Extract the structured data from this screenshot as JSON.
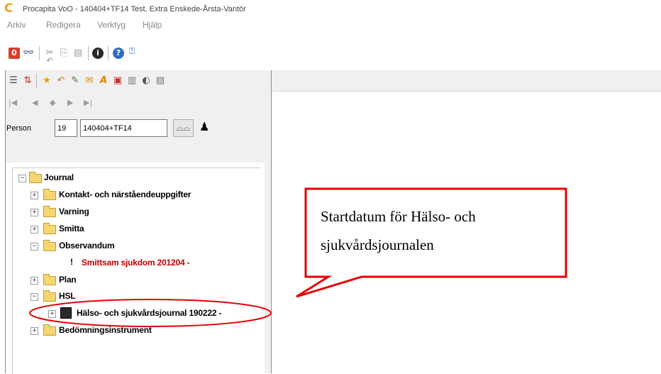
{
  "window": {
    "logo": "C",
    "title": "Procapita VoO - 140404+TF14 Test, Extra Enskede-Årsta-Vantör"
  },
  "menu": [
    "Arkiv",
    "Redigera",
    "Verktyg",
    "Hjälp"
  ],
  "toolbar1": [
    "stop-icon",
    "binoculars-icon",
    "cut-icon",
    "copy-icon",
    "paste-icon",
    "undo-icon",
    "info-icon",
    "help-icon",
    "context-help-icon"
  ],
  "toolbar2": [
    "indent-icon",
    "sort-icon",
    "star-icon",
    "undo-icon",
    "edit-icon",
    "mail-icon",
    "signature-icon",
    "form-icon",
    "book-icon",
    "circle-icon",
    "chart-icon"
  ],
  "nav": [
    "first-icon",
    "prev-icon",
    "current-icon",
    "next-icon",
    "last-icon"
  ],
  "person": {
    "label": "Person",
    "number": "19",
    "id": "140404+TF14"
  },
  "tree": {
    "root": "Journal",
    "items": [
      {
        "label": "Kontakt- och närståendeuppgifter",
        "expander": "+"
      },
      {
        "label": "Varning",
        "expander": "+"
      },
      {
        "label": "Smitta",
        "expander": "+"
      },
      {
        "label": "Observandum",
        "expander": "−"
      },
      {
        "label": "Smittsam sjukdom 201204 -",
        "expander": "",
        "warning": "!"
      },
      {
        "label": "Plan",
        "expander": "+"
      },
      {
        "label": "HSL",
        "expander": "−"
      },
      {
        "label": "Hälso- och sjukvårdsjournal 190222 -",
        "expander": "+"
      },
      {
        "label": "Bedömningsinstrument",
        "expander": "+"
      }
    ]
  },
  "callout": {
    "line1": "Startdatum för Hälso- och",
    "line2": "sjukvårdsjournalen"
  },
  "colors": {
    "annotation": "#e60000",
    "warning_text": "#c00000",
    "logo": "#f0a01e"
  }
}
